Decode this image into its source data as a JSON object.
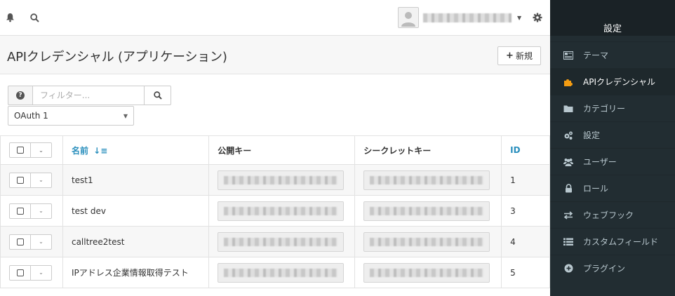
{
  "topbar": {
    "icons": [
      "bell-icon",
      "search-icon",
      "gear-icon"
    ]
  },
  "page": {
    "title": "APIクレデンシャル (アプリケーション)",
    "new_button": "新規"
  },
  "filter": {
    "placeholder": "フィルター...",
    "select_value": "OAuth 1"
  },
  "table": {
    "headers": {
      "name": "名前",
      "public_key": "公開キー",
      "secret_key": "シークレットキー",
      "id": "ID"
    },
    "rows": [
      {
        "name": "test1",
        "id": "1"
      },
      {
        "name": "test dev",
        "id": "3"
      },
      {
        "name": "calltree2test",
        "id": "4"
      },
      {
        "name": "IPアドレス企業情報取得テスト",
        "id": "5"
      }
    ]
  },
  "sidebar": {
    "title": "設定",
    "items": [
      {
        "label": "テーマ",
        "icon": "newspaper-icon"
      },
      {
        "label": "APIクレデンシャル",
        "icon": "puzzle-icon",
        "active": true
      },
      {
        "label": "カテゴリー",
        "icon": "folder-icon"
      },
      {
        "label": "設定",
        "icon": "cogs-icon"
      },
      {
        "label": "ユーザー",
        "icon": "users-icon"
      },
      {
        "label": "ロール",
        "icon": "lock-icon"
      },
      {
        "label": "ウェブフック",
        "icon": "exchange-icon"
      },
      {
        "label": "カスタムフィールド",
        "icon": "list-icon"
      },
      {
        "label": "プラグイン",
        "icon": "plus-circle-icon"
      }
    ]
  },
  "colors": {
    "sidebar_bg": "#222d32",
    "accent": "#2a8fbd",
    "active_icon": "#f39c12"
  }
}
